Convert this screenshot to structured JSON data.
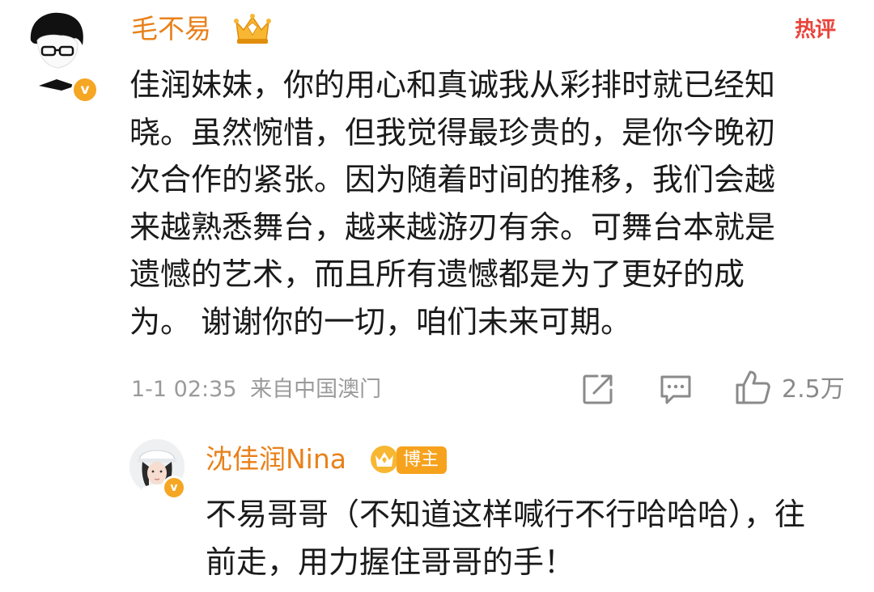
{
  "main_comment": {
    "username": "毛不易",
    "hot_label": "热评",
    "body_lines": [
      "佳润妹妹，你的用心和真诚我从彩排时就已经知",
      "晓。虽然惋惜，但我觉得最珍贵的，是你今晚初",
      "次合作的紧张。因为随着时间的推移，我们会越",
      "来越熟悉舞台，越来越游刃有余。可舞台本就是",
      "遗憾的艺术，而且所有遗憾都是为了更好的成",
      "为。 谢谢你的一切，咱们未来可期。"
    ],
    "time": "1-1 02:35",
    "location": "来自中国澳门",
    "like_count": "2.5万",
    "verified_mark": "v"
  },
  "reply": {
    "username": "沈佳润Nina",
    "badge": "博主",
    "verified_mark": "v",
    "body_lines": [
      "不易哥哥（不知道这样喊行不行哈哈哈），往",
      "前走，用力握住哥哥的手！"
    ]
  },
  "icons": {
    "share": "share-icon",
    "comment": "comment-icon",
    "like": "like-icon",
    "crown": "crown-icon"
  },
  "colors": {
    "username": "#e8811a",
    "hot": "#e8453c",
    "verified": "#f5a623",
    "meta": "#9a9a9a"
  }
}
